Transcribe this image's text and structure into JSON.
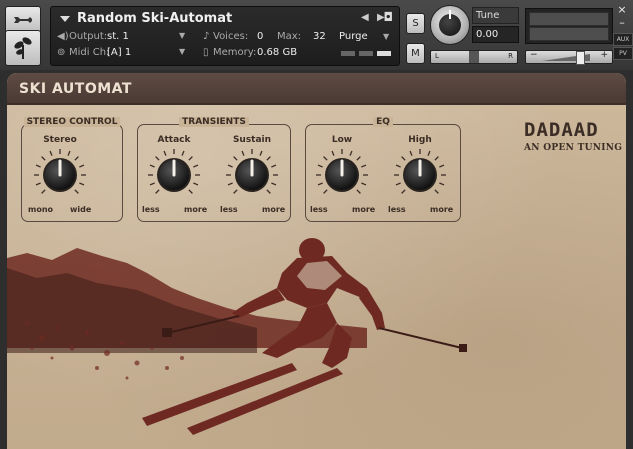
{
  "header": {
    "instrument_name": "Random Ski-Automat",
    "output_label": "Output:",
    "output_value": "st. 1",
    "voices_label": "Voices:",
    "voices_value": "0",
    "max_label": "Max:",
    "max_value": "32",
    "purge_label": "Purge",
    "midi_label": "Midi Ch:",
    "midi_value": "[A]  1",
    "memory_label": "Memory:",
    "memory_value": "0.68 GB",
    "solo_label": "S",
    "mute_label": "M",
    "tune_label": "Tune",
    "tune_value": "0.00",
    "pan_left": "L",
    "pan_right": "R",
    "vol_minus": "−",
    "vol_plus": "+",
    "aux_label": "AUX",
    "pv_label": "PV",
    "close_glyph": "×",
    "minimize_glyph": "–"
  },
  "panel": {
    "title": "SKI AUTOMAT",
    "logo_main": "DADAAD",
    "logo_sub": "AN OPEN TUNING"
  },
  "groups": [
    {
      "title": "STEREO CONTROL",
      "knobs": [
        {
          "label": "Stereo",
          "min_label": "mono",
          "max_label": "wide",
          "value": 0.5
        }
      ]
    },
    {
      "title": "TRANSIENTS",
      "knobs": [
        {
          "label": "Attack",
          "min_label": "less",
          "max_label": "more",
          "value": 0.5
        },
        {
          "label": "Sustain",
          "min_label": "less",
          "max_label": "more",
          "value": 0.5
        }
      ]
    },
    {
      "title": "EQ",
      "knobs": [
        {
          "label": "Low",
          "min_label": "less",
          "max_label": "more",
          "value": 0.5
        },
        {
          "label": "High",
          "min_label": "less",
          "max_label": "more",
          "value": 0.5
        }
      ]
    }
  ],
  "icons": {
    "wrench": "wrench-icon",
    "plant": "plant-icon",
    "camera": "camera-icon",
    "speaker": "speaker-icon",
    "midi": "midi-icon",
    "memory": "memory-icon",
    "voices": "voices-icon"
  },
  "colors": {
    "panel_bg": "#cab69a",
    "band_bg": "#4f3e36",
    "ink": "#3b2d25",
    "art_red": "#6e2a22"
  }
}
